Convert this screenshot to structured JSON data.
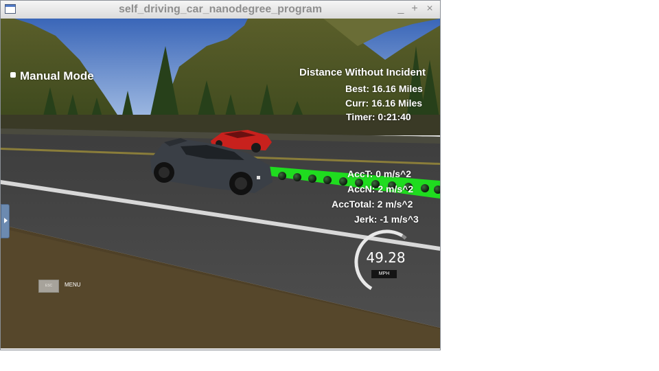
{
  "window": {
    "title": "self_driving_car_nanodegree_program",
    "controls": {
      "minimize": "_",
      "maximize": "+",
      "close": "×"
    }
  },
  "hud": {
    "mode_label": "Manual Mode",
    "distance_heading": "Distance Without Incident",
    "best": "Best: 16.16 Miles",
    "curr": "Curr: 16.16 Miles",
    "timer": "Timer: 0:21:40",
    "acc_t": "AccT: 0 m/s^2",
    "acc_n": "AccN: 2 m/s^2",
    "acc_total": "AccTotal: 2 m/s^2",
    "jerk": "Jerk: -1 m/s^3"
  },
  "speedometer": {
    "value": "49.28",
    "unit": "MPH"
  },
  "menu": {
    "esc_label": "ESC",
    "menu_label": "MENU"
  },
  "colors": {
    "path_green": "#1fdc1f",
    "ego_car": "#3a3f46",
    "other_car": "#d6231f",
    "sky": "#4a72c0"
  }
}
